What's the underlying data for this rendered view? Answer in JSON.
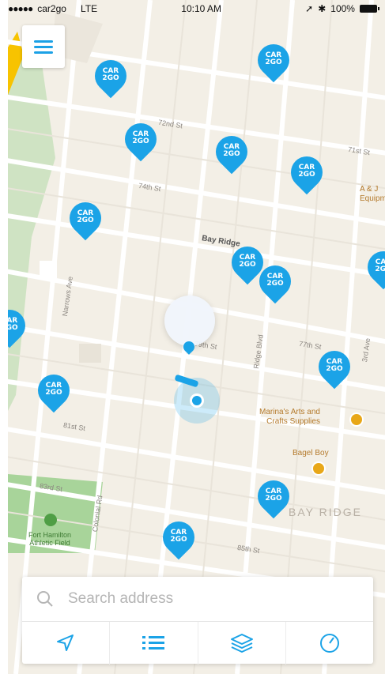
{
  "status_bar": {
    "carrier": "car2go",
    "network": "LTE",
    "time": "10:10 AM",
    "battery": "100%"
  },
  "map": {
    "pin_logo_top": "CAR",
    "pin_logo_bottom": "2GO",
    "street_labels": {
      "s72nd": "72nd St",
      "s71st": "71st St",
      "s74th": "74th St",
      "bay_ridge_pkwy": "Bay Ridge",
      "s77th": "77th St",
      "s79th": "79th St",
      "s81st": "81st St",
      "s83rd": "83rd St",
      "s85th": "85th St",
      "narrows_ave": "Narrows Ave",
      "ridge_blvd": "Ridge Blvd",
      "third_ave": "3rd Ave",
      "colonial_rd": "Colonial Rd"
    },
    "poi": {
      "store_line1": "Marina's Arts and",
      "store_line2": "Crafts Supplies",
      "bagel": "Bagel Boy",
      "equip_line1": "A & J",
      "equip_line2": "Equipme"
    },
    "area_label": "BAY RIDGE",
    "park_line1": "Fort Hamilton",
    "park_line2": "Athletic Field",
    "colors": {
      "accent": "#1ba3e7",
      "map_bg": "#f3efe6",
      "park": "#a8d49a"
    }
  },
  "menu": {
    "icon": "hamburger-menu-icon"
  },
  "search": {
    "placeholder": "Search address"
  },
  "toolbar": {
    "icons": [
      "navigation-arrow-icon",
      "list-icon",
      "layers-icon",
      "gauge-icon"
    ]
  }
}
